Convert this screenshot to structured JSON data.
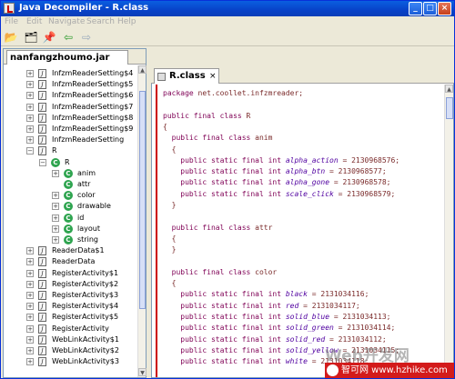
{
  "window": {
    "title": "Java Decompiler - R.class"
  },
  "menu": [
    "File",
    "Edit",
    "Navigate",
    "Search",
    "Help"
  ],
  "toolbar": {
    "open_icon": "open-folder-icon",
    "save_icon": "save-all-icon",
    "pin_icon": "pin-icon",
    "back_icon": "back-arrow-icon",
    "forward_icon": "forward-arrow-icon"
  },
  "left_tab": {
    "label": "nanfangzhoumo.jar"
  },
  "tree": [
    {
      "label": "InfzmReaderSetting$4",
      "kind": "file",
      "indent": 0
    },
    {
      "label": "InfzmReaderSetting$5",
      "kind": "file",
      "indent": 0
    },
    {
      "label": "InfzmReaderSetting$6",
      "kind": "file",
      "indent": 0
    },
    {
      "label": "InfzmReaderSetting$7",
      "kind": "file",
      "indent": 0
    },
    {
      "label": "InfzmReaderSetting$8",
      "kind": "file",
      "indent": 0
    },
    {
      "label": "InfzmReaderSetting$9",
      "kind": "file",
      "indent": 0
    },
    {
      "label": "InfzmReaderSetting",
      "kind": "file",
      "indent": 0
    },
    {
      "label": "R",
      "kind": "file-open",
      "indent": 0
    },
    {
      "label": "R",
      "kind": "class-open",
      "indent": 1
    },
    {
      "label": "anim",
      "kind": "class",
      "indent": 2
    },
    {
      "label": "attr",
      "kind": "class-leaf",
      "indent": 2
    },
    {
      "label": "color",
      "kind": "class",
      "indent": 2
    },
    {
      "label": "drawable",
      "kind": "class",
      "indent": 2
    },
    {
      "label": "id",
      "kind": "class",
      "indent": 2
    },
    {
      "label": "layout",
      "kind": "class",
      "indent": 2
    },
    {
      "label": "string",
      "kind": "class",
      "indent": 2
    },
    {
      "label": "ReaderData$1",
      "kind": "file",
      "indent": 0
    },
    {
      "label": "ReaderData",
      "kind": "file",
      "indent": 0
    },
    {
      "label": "RegisterActivity$1",
      "kind": "file",
      "indent": 0
    },
    {
      "label": "RegisterActivity$2",
      "kind": "file",
      "indent": 0
    },
    {
      "label": "RegisterActivity$3",
      "kind": "file",
      "indent": 0
    },
    {
      "label": "RegisterActivity$4",
      "kind": "file",
      "indent": 0
    },
    {
      "label": "RegisterActivity$5",
      "kind": "file",
      "indent": 0
    },
    {
      "label": "RegisterActivity",
      "kind": "file",
      "indent": 0
    },
    {
      "label": "WebLinkActivity$1",
      "kind": "file",
      "indent": 0
    },
    {
      "label": "WebLinkActivity$2",
      "kind": "file",
      "indent": 0
    },
    {
      "label": "WebLinkActivity$3",
      "kind": "file",
      "indent": 0
    }
  ],
  "editor_tab": {
    "label": "R.class",
    "close": "×"
  },
  "code_lines": [
    [
      {
        "t": "package ",
        "c": "kw"
      },
      {
        "t": "net.coollet.infzmreader;",
        "c": ""
      }
    ],
    [],
    [
      {
        "t": "public final class ",
        "c": "kw"
      },
      {
        "t": "R",
        "c": ""
      }
    ],
    [
      {
        "t": "{",
        "c": ""
      }
    ],
    [
      {
        "t": "  public final class ",
        "c": "kw"
      },
      {
        "t": "anim",
        "c": ""
      }
    ],
    [
      {
        "t": "  {",
        "c": ""
      }
    ],
    [
      {
        "t": "    public static final int ",
        "c": "kw"
      },
      {
        "t": "alpha_action",
        "c": "fld"
      },
      {
        "t": " = 2130968576;",
        "c": ""
      }
    ],
    [
      {
        "t": "    public static final int ",
        "c": "kw"
      },
      {
        "t": "alpha_btn",
        "c": "fld"
      },
      {
        "t": " = 2130968577;",
        "c": ""
      }
    ],
    [
      {
        "t": "    public static final int ",
        "c": "kw"
      },
      {
        "t": "alpha_gone",
        "c": "fld"
      },
      {
        "t": " = 2130968578;",
        "c": ""
      }
    ],
    [
      {
        "t": "    public static final int ",
        "c": "kw"
      },
      {
        "t": "scale_click",
        "c": "fld"
      },
      {
        "t": " = 2130968579;",
        "c": ""
      }
    ],
    [
      {
        "t": "  }",
        "c": ""
      }
    ],
    [],
    [
      {
        "t": "  public final class ",
        "c": "kw"
      },
      {
        "t": "attr",
        "c": ""
      }
    ],
    [
      {
        "t": "  {",
        "c": ""
      }
    ],
    [
      {
        "t": "  }",
        "c": ""
      }
    ],
    [],
    [
      {
        "t": "  public final class ",
        "c": "kw"
      },
      {
        "t": "color",
        "c": ""
      }
    ],
    [
      {
        "t": "  {",
        "c": ""
      }
    ],
    [
      {
        "t": "    public static final int ",
        "c": "kw"
      },
      {
        "t": "black",
        "c": "fld"
      },
      {
        "t": " = 2131034116;",
        "c": ""
      }
    ],
    [
      {
        "t": "    public static final int ",
        "c": "kw"
      },
      {
        "t": "red",
        "c": "fld"
      },
      {
        "t": " = 2131034117;",
        "c": ""
      }
    ],
    [
      {
        "t": "    public static final int ",
        "c": "kw"
      },
      {
        "t": "solid_blue",
        "c": "fld"
      },
      {
        "t": " = 2131034113;",
        "c": ""
      }
    ],
    [
      {
        "t": "    public static final int ",
        "c": "kw"
      },
      {
        "t": "solid_green",
        "c": "fld"
      },
      {
        "t": " = 2131034114;",
        "c": ""
      }
    ],
    [
      {
        "t": "    public static final int ",
        "c": "kw"
      },
      {
        "t": "solid_red",
        "c": "fld"
      },
      {
        "t": " = 2131034112;",
        "c": ""
      }
    ],
    [
      {
        "t": "    public static final int ",
        "c": "kw"
      },
      {
        "t": "solid_yellow",
        "c": "fld"
      },
      {
        "t": " = 2131034115;",
        "c": ""
      }
    ],
    [
      {
        "t": "    public static final int ",
        "c": "kw"
      },
      {
        "t": "white",
        "c": "fld"
      },
      {
        "t": " = 2131034118;",
        "c": ""
      }
    ]
  ],
  "watermark": {
    "text": "Web开发网"
  },
  "brand_bar": {
    "text": "智可网 www.hzhike.com"
  }
}
